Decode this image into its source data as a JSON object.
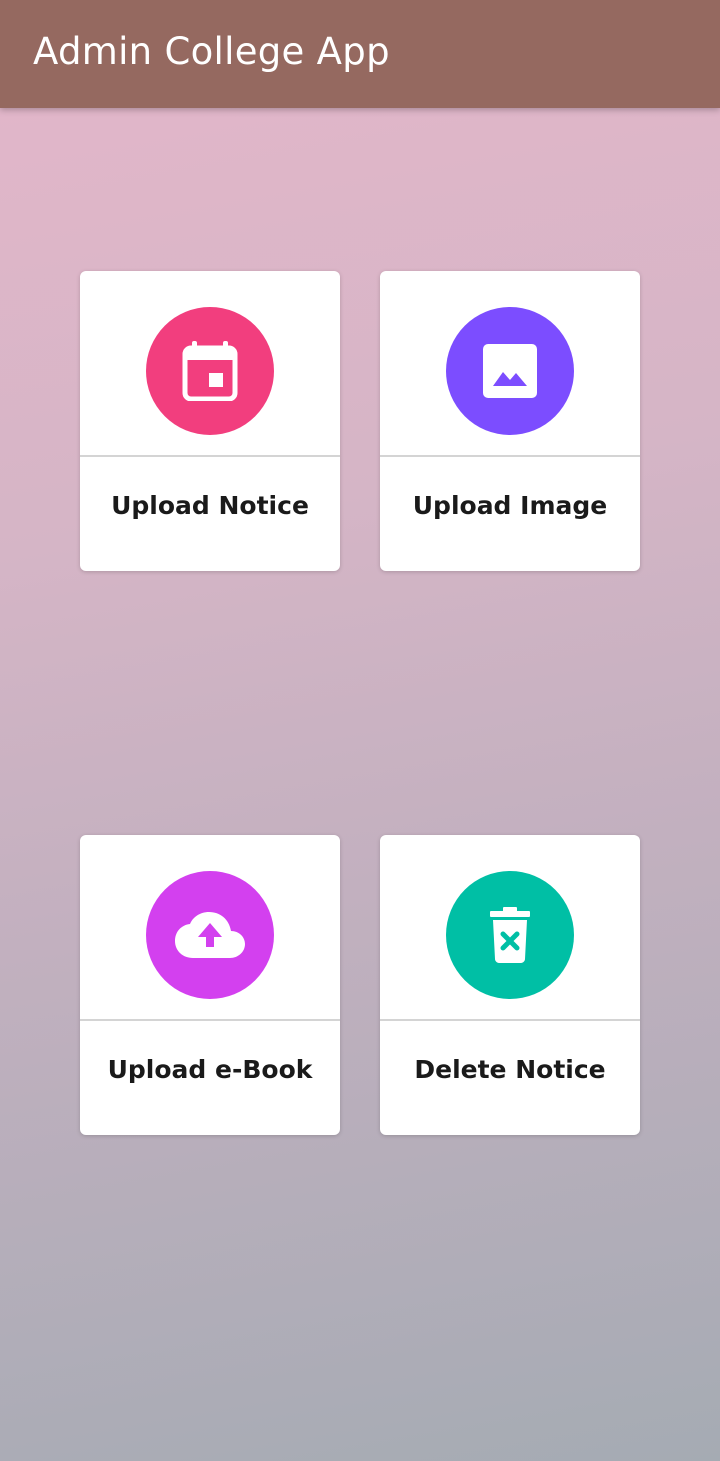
{
  "appbar": {
    "title": "Admin College App",
    "color": "#956960"
  },
  "cards": [
    {
      "label": "Upload Notice",
      "icon": "calendar-icon",
      "color": "#f23e7e"
    },
    {
      "label": "Upload Image",
      "icon": "image-icon",
      "color": "#7c4dff"
    },
    {
      "label": "Upload e-Book",
      "icon": "cloud-upload-icon",
      "color": "#d340ef"
    },
    {
      "label": "Delete Notice",
      "icon": "delete-icon",
      "color": "#00bfa5"
    }
  ]
}
